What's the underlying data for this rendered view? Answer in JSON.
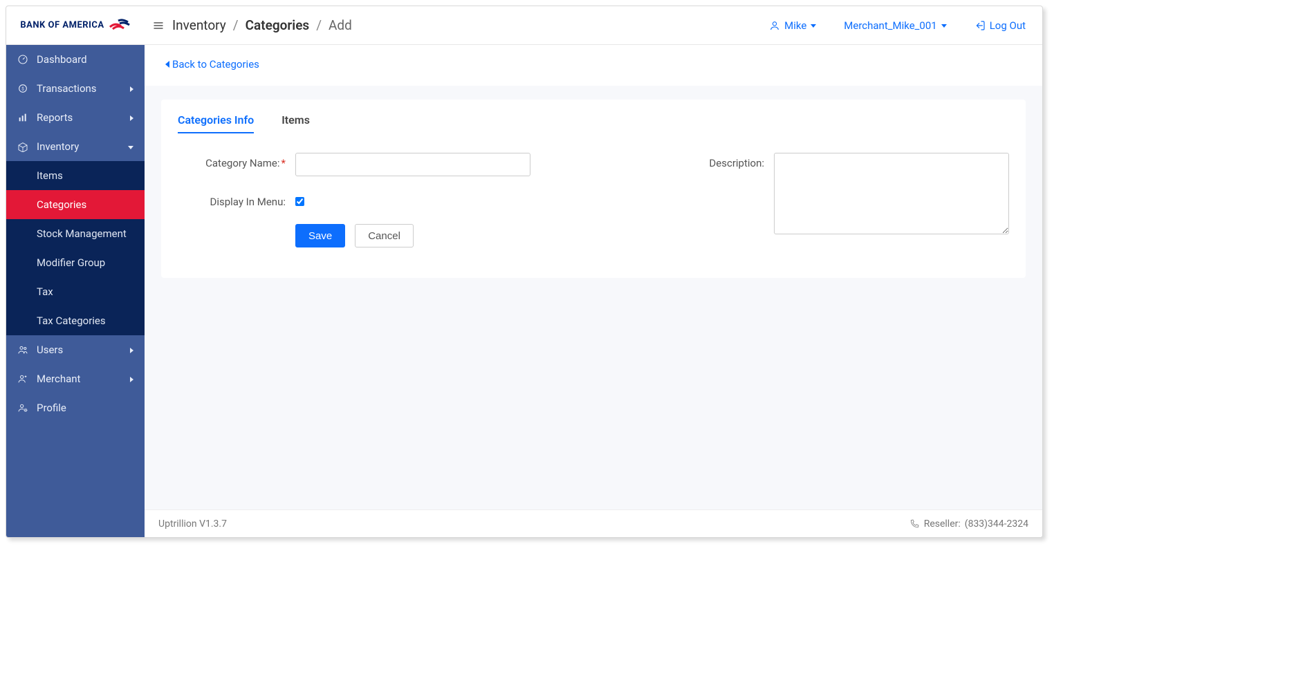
{
  "brand": {
    "name": "BANK OF AMERICA"
  },
  "breadcrumb": {
    "lvl1": "Inventory",
    "lvl2": "Categories",
    "lvl3": "Add"
  },
  "header": {
    "user": "Mike",
    "merchant": "Merchant_Mike_001",
    "logout": "Log Out"
  },
  "sidebar": {
    "items": [
      {
        "label": "Dashboard",
        "icon": "gauge"
      },
      {
        "label": "Transactions",
        "icon": "money",
        "expandable": true
      },
      {
        "label": "Reports",
        "icon": "chart",
        "expandable": true
      },
      {
        "label": "Inventory",
        "icon": "box",
        "expandable": true,
        "expanded": true
      },
      {
        "label": "Users",
        "icon": "users",
        "expandable": true
      },
      {
        "label": "Merchant",
        "icon": "person-plus",
        "expandable": true
      },
      {
        "label": "Profile",
        "icon": "person-gear"
      }
    ],
    "inventory_sub": [
      {
        "label": "Items"
      },
      {
        "label": "Categories",
        "active": true
      },
      {
        "label": "Stock Management"
      },
      {
        "label": "Modifier Group"
      },
      {
        "label": "Tax"
      },
      {
        "label": "Tax Categories"
      }
    ]
  },
  "page": {
    "back_label": "Back to Categories",
    "tabs": {
      "info": "Categories Info",
      "items": "Items"
    },
    "form": {
      "category_name_label": "Category Name:",
      "category_name_value": "",
      "description_label": "Description:",
      "description_value": "",
      "display_in_menu_label": "Display In Menu:",
      "display_in_menu_checked": true,
      "save": "Save",
      "cancel": "Cancel"
    }
  },
  "footer": {
    "version": "Uptrillion V1.3.7",
    "reseller_label": "Reseller:",
    "reseller_phone": "(833)344-2324"
  }
}
